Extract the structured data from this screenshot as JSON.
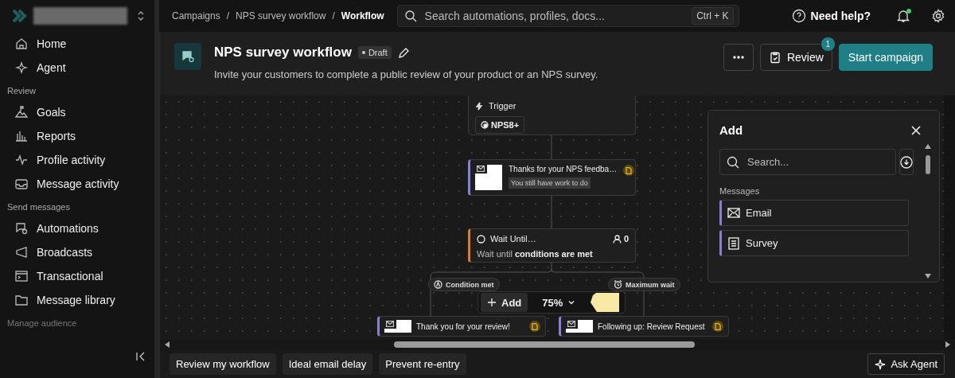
{
  "sidebar": {
    "sections": [
      {
        "items": [
          "Home",
          "Agent"
        ]
      },
      {
        "heading": "Review",
        "items": [
          "Goals",
          "Reports",
          "Profile activity",
          "Message activity"
        ]
      },
      {
        "heading": "Send messages",
        "items": [
          "Automations",
          "Broadcasts",
          "Transactional",
          "Message library"
        ]
      },
      {
        "heading": "Manage audience"
      }
    ]
  },
  "topbar": {
    "breadcrumbs": [
      "Campaigns",
      "NPS survey workflow",
      "Workflow"
    ],
    "breadcrumb_separator": "/",
    "search": {
      "placeholder": "Search automations, profiles, docs...",
      "shortcut": "Ctrl + K"
    },
    "help": "Need help?",
    "notifications_unread": true
  },
  "header": {
    "title": "NPS survey workflow",
    "status": "Draft",
    "description": "Invite your customers to complete a public review of your product or an NPS survey.",
    "review_button": {
      "label": "Review",
      "badge": "1"
    },
    "primary_button": "Start campaign"
  },
  "canvas": {
    "nodes": [
      {
        "kind": "trigger",
        "title": "Trigger",
        "chip": "NPS8+"
      },
      {
        "kind": "message",
        "title": "Thanks for your NPS feedba…",
        "note": "You still have work to do"
      },
      {
        "kind": "wait",
        "title": "Wait Until…",
        "count": "0",
        "description": "Wait until **conditions are met**"
      },
      {
        "kind": "message",
        "title": "Thank you for your review!"
      },
      {
        "kind": "message",
        "title": "Following up: Review Request"
      }
    ],
    "branches": [
      "Condition met",
      "Maximum wait"
    ],
    "toolbar": {
      "add": "Add",
      "zoom": "75%"
    }
  },
  "add_panel": {
    "title": "Add",
    "search": {
      "placeholder": "Search..."
    },
    "section": "Messages",
    "items": [
      "Email",
      "Survey"
    ]
  },
  "bottom_bar": {
    "suggestions": [
      "Review my workflow",
      "Ideal email delay",
      "Prevent re-entry"
    ],
    "ask": "Ask Agent"
  }
}
